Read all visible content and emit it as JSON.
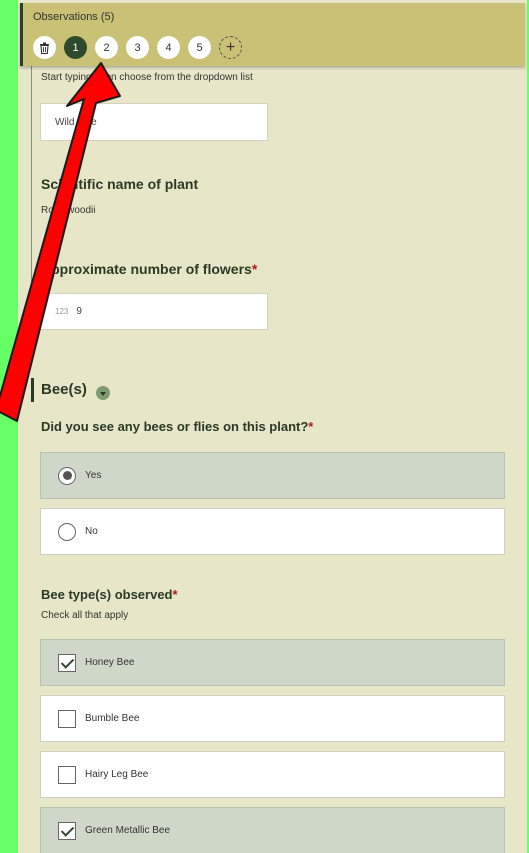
{
  "header": {
    "title": "Observations (5)",
    "pages": [
      "1",
      "2",
      "3",
      "4",
      "5"
    ],
    "active_page": "1",
    "add_symbol": "+"
  },
  "plant": {
    "hint": "Start typing, then choose from the dropdown list",
    "name_value": "Wild rose",
    "scientific_label": "Scientific name of plant",
    "scientific_value": "Rosa woodii",
    "flowers_label": "Approximate number of flowers",
    "flowers_icon": "123",
    "flowers_value": "9",
    "required_mark": "*"
  },
  "bees": {
    "section_title": "Bee(s)",
    "question": "Did you see any bees or flies on this plant?",
    "options": [
      {
        "label": "Yes",
        "selected": true
      },
      {
        "label": "No",
        "selected": false
      }
    ],
    "types_label": "Bee type(s) observed",
    "types_hint": "Check all that apply",
    "types": [
      {
        "label": "Honey Bee",
        "checked": true
      },
      {
        "label": "Bumble Bee",
        "checked": false
      },
      {
        "label": "Hairy Leg Bee",
        "checked": false
      },
      {
        "label": "Green Metallic Bee",
        "checked": true
      }
    ]
  },
  "colors": {
    "page_background": "#66ff66",
    "panel": "#e8e6c9",
    "header": "#c8c176",
    "active_page": "#2d4a2d",
    "selected_option": "#cfd8c8",
    "required": "#b01c1c",
    "annotation_arrow": "#ff0000"
  }
}
